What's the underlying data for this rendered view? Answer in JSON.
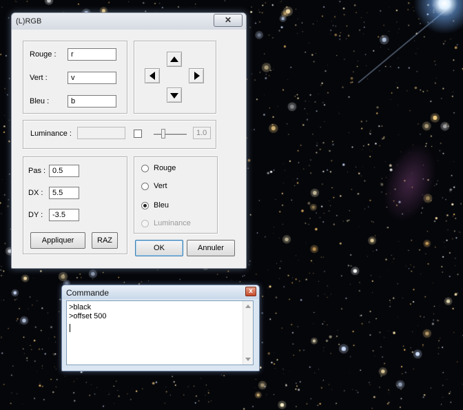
{
  "colors": {
    "window_bg": "#f0f0f0",
    "cmd_close_red": "#c44a2a",
    "default_button_border": "#3c7fb1"
  },
  "dialog": {
    "title": "(L)RGB",
    "close_symbol": "✕",
    "channels": [
      {
        "label": "Rouge :",
        "value": "r"
      },
      {
        "label": "Vert :",
        "value": "v"
      },
      {
        "label": "Bleu :",
        "value": "b"
      }
    ],
    "nav_icons": [
      "up-arrow-icon",
      "left-arrow-icon",
      "right-arrow-icon",
      "down-arrow-icon"
    ],
    "luminance": {
      "label": "Luminance :",
      "value": "",
      "checked": false,
      "slider_level": 0.25,
      "level_value": "1.0"
    },
    "params": [
      {
        "label": "Pas :",
        "value": "0.5"
      },
      {
        "label": "DX :",
        "value": "5.5"
      },
      {
        "label": "DY :",
        "value": "-3.5"
      }
    ],
    "apply_label": "Appliquer",
    "raz_label": "RAZ",
    "radio_options": [
      {
        "label": "Rouge",
        "checked": false,
        "disabled": false
      },
      {
        "label": "Vert",
        "checked": false,
        "disabled": false
      },
      {
        "label": "Bleu",
        "checked": true,
        "disabled": false
      },
      {
        "label": "Luminance",
        "checked": false,
        "disabled": true
      }
    ],
    "ok_label": "OK",
    "cancel_label": "Annuler"
  },
  "command_window": {
    "title": "Commande",
    "close_symbol": "x",
    "lines": [
      ">black",
      ">offset 500"
    ]
  }
}
